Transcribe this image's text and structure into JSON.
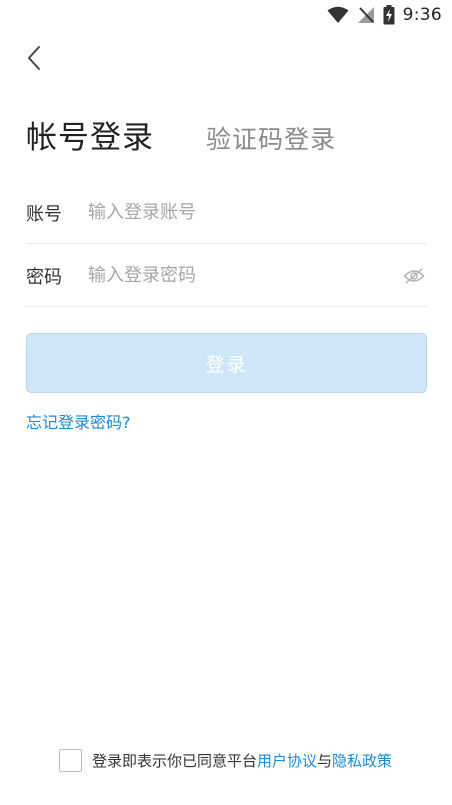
{
  "status_bar": {
    "time": "9:36",
    "icons": [
      "wifi-icon",
      "no-signal-icon",
      "battery-charging-icon"
    ]
  },
  "nav": {
    "back_icon": "chevron-left-icon"
  },
  "tabs": {
    "active": "帐号登录",
    "inactive": "验证码登录"
  },
  "form": {
    "account": {
      "label": "账号",
      "placeholder": "输入登录账号",
      "value": ""
    },
    "password": {
      "label": "密码",
      "placeholder": "输入登录密码",
      "value": "",
      "toggle_icon": "eye-off-icon"
    }
  },
  "login_button": {
    "label": "登录",
    "enabled": false
  },
  "forgot_password": "忘记登录密码?",
  "agreement": {
    "checked": false,
    "prefix": "登录即表示你已同意平台",
    "user_agreement": "用户协议",
    "conjunction": "与",
    "privacy_policy": "隐私政策"
  },
  "colors": {
    "accent": "#1e88d0",
    "button_disabled_bg": "#cfe6f8",
    "placeholder": "#a6a6a6"
  }
}
